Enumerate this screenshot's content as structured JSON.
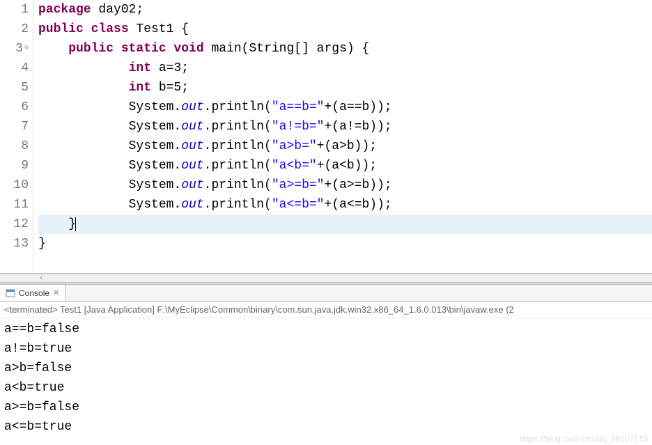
{
  "editor": {
    "lines": [
      {
        "num": "1",
        "hl": false,
        "tokens": [
          [
            "kw",
            "package"
          ],
          [
            "plain",
            " day02;"
          ]
        ]
      },
      {
        "num": "2",
        "hl": false,
        "tokens": [
          [
            "kw",
            "public class"
          ],
          [
            "plain",
            " Test1 {"
          ]
        ]
      },
      {
        "num": "3",
        "hl": true,
        "marker": "⊖",
        "tokens": [
          [
            "plain",
            "    "
          ],
          [
            "kw",
            "public static void"
          ],
          [
            "plain",
            " main(String[] args) {"
          ]
        ]
      },
      {
        "num": "4",
        "hl": true,
        "tokens": [
          [
            "plain",
            "            "
          ],
          [
            "type",
            "int"
          ],
          [
            "plain",
            " a=3;"
          ]
        ]
      },
      {
        "num": "5",
        "hl": true,
        "tokens": [
          [
            "plain",
            "            "
          ],
          [
            "type",
            "int"
          ],
          [
            "plain",
            " b=5;"
          ]
        ]
      },
      {
        "num": "6",
        "hl": true,
        "tokens": [
          [
            "plain",
            "            System."
          ],
          [
            "static-field",
            "out"
          ],
          [
            "plain",
            ".println("
          ],
          [
            "str",
            "\"a==b=\""
          ],
          [
            "plain",
            "+(a==b));"
          ]
        ]
      },
      {
        "num": "7",
        "hl": true,
        "tokens": [
          [
            "plain",
            "            System."
          ],
          [
            "static-field",
            "out"
          ],
          [
            "plain",
            ".println("
          ],
          [
            "str",
            "\"a!=b=\""
          ],
          [
            "plain",
            "+(a!=b));"
          ]
        ]
      },
      {
        "num": "8",
        "hl": true,
        "tokens": [
          [
            "plain",
            "            System."
          ],
          [
            "static-field",
            "out"
          ],
          [
            "plain",
            ".println("
          ],
          [
            "str",
            "\"a>b=\""
          ],
          [
            "plain",
            "+(a>b));"
          ]
        ]
      },
      {
        "num": "9",
        "hl": true,
        "tokens": [
          [
            "plain",
            "            System."
          ],
          [
            "static-field",
            "out"
          ],
          [
            "plain",
            ".println("
          ],
          [
            "str",
            "\"a<b=\""
          ],
          [
            "plain",
            "+(a<b));"
          ]
        ]
      },
      {
        "num": "10",
        "hl": true,
        "tokens": [
          [
            "plain",
            "            System."
          ],
          [
            "static-field",
            "out"
          ],
          [
            "plain",
            ".println("
          ],
          [
            "str",
            "\"a>=b=\""
          ],
          [
            "plain",
            "+(a>=b));"
          ]
        ]
      },
      {
        "num": "11",
        "hl": true,
        "tokens": [
          [
            "plain",
            "            System."
          ],
          [
            "static-field",
            "out"
          ],
          [
            "plain",
            ".println("
          ],
          [
            "str",
            "\"a<=b=\""
          ],
          [
            "plain",
            "+(a<=b));"
          ]
        ]
      },
      {
        "num": "12",
        "hl": true,
        "current": true,
        "tokens": [
          [
            "plain",
            "    }"
          ]
        ],
        "cursor": true
      },
      {
        "num": "13",
        "hl": false,
        "tokens": [
          [
            "plain",
            "}"
          ]
        ]
      }
    ],
    "scroll_hint": "‹"
  },
  "console": {
    "tab_label": "Console",
    "terminated_line": "<terminated> Test1 [Java Application] F:\\MyEclipse\\Common\\binary\\com.sun.java.jdk.win32.x86_64_1.6.0.013\\bin\\javaw.exe (2",
    "output": [
      "a==b=false",
      "a!=b=true",
      "a>b=false",
      "a<b=true",
      "a>=b=false",
      "a<=b=true"
    ]
  },
  "watermark": "https://blog.csdn.net/qq_38007715"
}
